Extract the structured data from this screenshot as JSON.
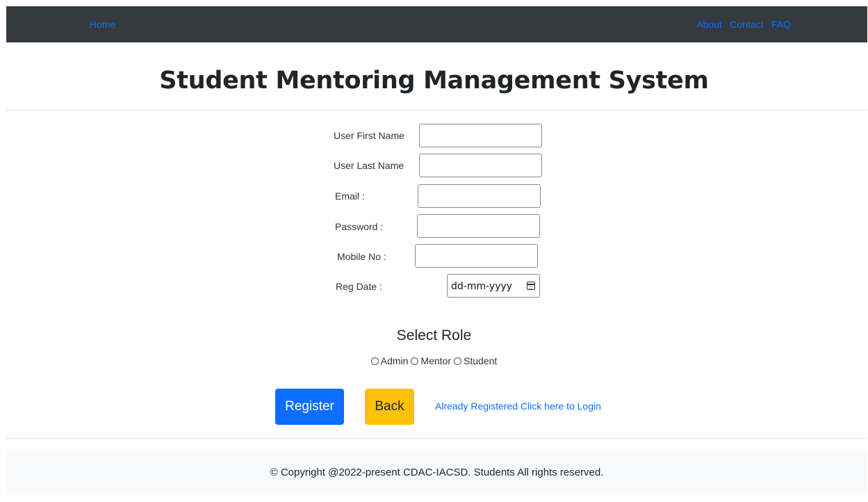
{
  "nav": {
    "home": "Home",
    "about": "About",
    "contact": "Contact",
    "faq": "FAQ"
  },
  "header": {
    "title": "Student Mentoring Management System"
  },
  "form": {
    "first_name_label": "User First Name",
    "last_name_label": "User Last Name",
    "email_label": "Email :",
    "password_label": "Password :",
    "mobile_label": "Mobile No :",
    "reg_date_label": "Reg Date :",
    "reg_date_placeholder": "dd-mm-yyyy"
  },
  "role": {
    "title": "Select Role",
    "options": [
      "Admin",
      "Mentor",
      "Student"
    ]
  },
  "actions": {
    "register": "Register",
    "back": "Back",
    "login_link": "Already Registered Click here to Login"
  },
  "footer": {
    "text": "© Copyright @2022-present CDAC-IACSD. Students All rights reserved."
  },
  "colors": {
    "navbar": "#343a40",
    "link": "#0d6efd",
    "primary": "#0d6efd",
    "warning": "#ffc107"
  }
}
